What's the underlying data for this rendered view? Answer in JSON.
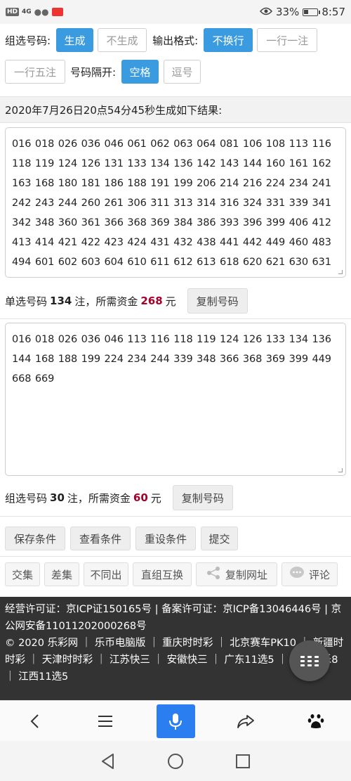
{
  "status_bar": {
    "left_icons": [
      "HD",
      "4G",
      "wechat-icon",
      "app-icon"
    ],
    "battery": "33%",
    "battery_level": 0.33,
    "time": "8:57"
  },
  "options": {
    "group_label": "组选号码:",
    "generate": "生成",
    "no_generate": "不生成",
    "format_label": "输出格式:",
    "no_wrap": "不换行",
    "one_per_line": "一行一注",
    "five_per_line": "一行五注",
    "separator_label": "号码隔开:",
    "space": "空格",
    "comma": "逗号"
  },
  "result_header": "2020年7月26日20点54分45秒生成如下结果:",
  "single": {
    "numbers": "016 018 026 036 046 061 062 063 064 081 106 108 113 116 118 119 124 126 131 133 134 136 142 143 144 160 161 162 163 168 180 181 186 188 191 199 206 214 216 224 234 241 242 243 244 260 261 306 311 313 314 316 324 331 339 341 342 348 360 361 366 368 369 384 386 393 396 399 406 412 413 414 421 422 423 424 431 432 438 441 442 449 460 483 494 601 602 603 604 610 611 612 613 618 620 621 630 631",
    "prefix": "单选号码",
    "count": "134",
    "mid": "注，所需资金",
    "money": "268",
    "suffix": "元",
    "copy": "复制号码"
  },
  "group": {
    "numbers": "016 018 026 036 046 113 116 118 119 124 126 133 134 136 144 168 188 199 224 234 244 339 348 366 368 369 399 449 668 669",
    "prefix": "组选号码",
    "count": "30",
    "mid": "注，所需资金",
    "money": "60",
    "suffix": "元",
    "copy": "复制号码"
  },
  "actions": {
    "save": "保存条件",
    "view": "查看条件",
    "reset": "重设条件",
    "submit": "提交"
  },
  "tools": {
    "intersect": "交集",
    "diff": "差集",
    "not_same": "不同出",
    "swap": "直组互换",
    "copy_url": "复制网址",
    "comment": "评论"
  },
  "footer": {
    "line1": "经营许可证：京ICP证150165号 | 备案许可证：京ICP备13046446号 | 京公网安备11011202000268号",
    "line2": "© 2020 乐彩网 ｜ 乐币电脑版 ｜ 重庆时时彩 ｜ 北京赛车PK10 ｜ 新疆时时彩 ｜ 天津时时彩 ｜ 江苏快三 ｜ 安徽快三 ｜ 广东11选5 ｜ 北京快乐8 ｜ 江西11选5"
  },
  "colors": {
    "accent": "#3a9be0",
    "money": "#a4002a",
    "footer_bg": "#333333",
    "mic_bg": "#2a7ef0"
  }
}
